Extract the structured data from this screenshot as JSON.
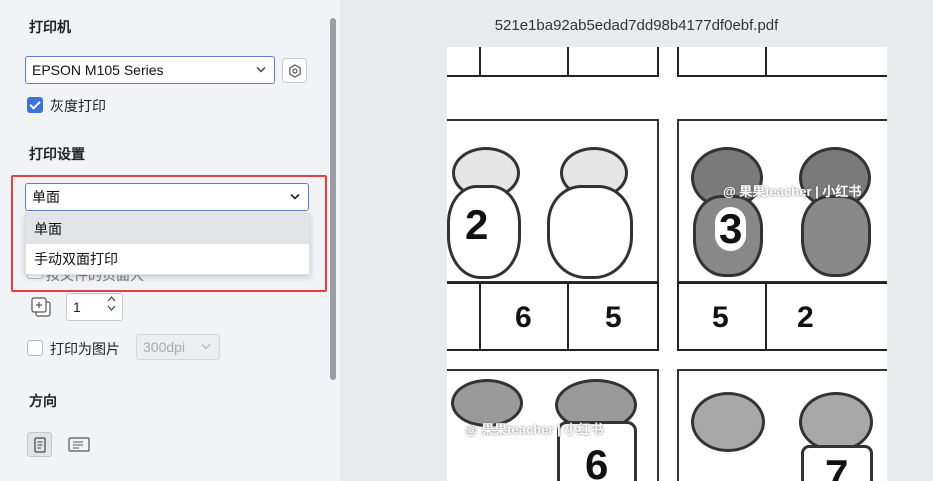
{
  "left_panel": {
    "printer_section_title": "打印机",
    "printer_select_value": "EPSON M105 Series",
    "grayscale_label": "灰度打印",
    "print_settings_title": "打印设置",
    "duplex_select_value": "单面",
    "duplex_options": [
      "单面",
      "手动双面打印"
    ],
    "hidden_row_text": "按文件的页面大",
    "copies_value": "1",
    "print_as_image_label": "打印为图片",
    "dpi_value": "300dpi",
    "orientation_title": "方向"
  },
  "preview": {
    "filename": "521e1ba92ab5edad7dd98b4177df0ebf.pdf",
    "numbers_row1": [
      "2",
      "3"
    ],
    "numbers_row2": [
      "6",
      "5",
      "5",
      "2"
    ],
    "numbers_row3": [
      "6",
      "7"
    ],
    "watermark": "@ 果果teacher | 小红书",
    "watermark2": "@ 果果teacher | 小红书"
  },
  "colors": {
    "accent": "#3b74d6",
    "highlight": "#e04040",
    "panel_bg": "#f2f3f6",
    "preview_bg": "#e9ebef"
  }
}
